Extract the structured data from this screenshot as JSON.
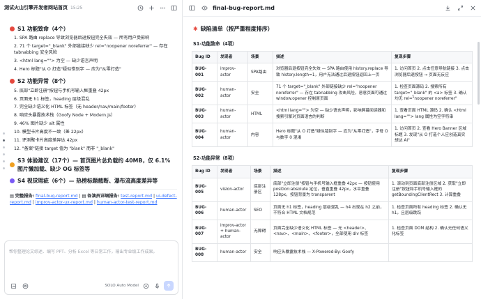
{
  "left": {
    "title": "测试火山引擎开发者网站首页",
    "time": "15:25",
    "sections": [
      {
        "color": "#e5483e",
        "heading": "S1 功能致命（4个）",
        "items": [
          "1. SPA 路由 replace 导致浏览器后退按钮完全失效 — 所有用户受影响",
          "2. 71 个 target=\"_blank\" 外部链接缺少 rel=\"noopener noreferrer\" — 存在 tabnabbing 安全风险",
          "3. <html lang=\"\"> 为空 — 缺少语言声明",
          "4. Hero 标题\"从 O 打造\"疑似错别字 — 应为\"从零打造\""
        ]
      },
      {
        "color": "#e5483e",
        "heading": "S2 功能异常（8个）",
        "items": [
          "5. 底部\"立即注册\"按钮与手机号输入框重叠 42px",
          "6. 页面无 h1 标签，heading 层级混乱",
          "7. 完全缺少语义化 HTML 标签（无 header/nav/main/footer）",
          "8. 响应头暴露技术栈（Goofy Node + Modern.js）",
          "9. 46% 图片缺少 alt 属性",
          "10. 模型卡片高度不一致（差 22px）",
          "11. 评测聚卡片高度差异达 42px",
          "12. \"备案\"链接 target 值为 \"blank\" 而非 \"_blank\""
        ]
      },
      {
        "color": "#f0a020",
        "heading": "S3 体验建议（17个）— 首页图片总负载约 40MB，仅 6.1% 图片懒加载、缺少 OG 标签等",
        "items": []
      },
      {
        "color": "#7a5af5",
        "heading": "S4 视觉瑕疵（6个）— 热榜标题截断、瀑布流高度差异等",
        "items": []
      }
    ],
    "report": {
      "icon_label": "完整报告:",
      "main_link": "final-bug-report.md",
      "sep1": " | ",
      "sub_label": "各演员详细报告:",
      "links": [
        "test-report.md",
        "ui-defect-report.md",
        "improv-actor-ux-report.md",
        "human-actor-test-report.md"
      ]
    },
    "composer": {
      "placeholder": "帮你整理论文综述、编写 PPT、分析 Excel 等日常工作，输出专业级工作成果。",
      "model": "SOLO Auto Model"
    }
  },
  "right": {
    "filename": "final-bug-report.md",
    "heading": "缺陷清单（按严重程度排序）",
    "table1": {
      "title": "S1-功能致命（4项）",
      "headers": [
        "Bug ID",
        "发现者",
        "场景",
        "描述",
        "复现步骤"
      ],
      "rows": [
        [
          "BUG-001",
          "improv-actor",
          "SPA路由",
          "浏览器后退按钮完全失效 — SPA 路由使用 history.replace 导致 history.length=1，用户无法通过后退按钮返回上一页",
          "1. 访问首页 2. 点击任意导航链接 3. 点击浏览器后退按钮 → 页面无反应"
        ],
        [
          "BUG-002",
          "human-actor",
          "安全",
          "71 个 target=\"_blank\" 外部链接缺少 rel=\"noopener noreferrer\" — 存在 tabnabbing 攻击风险，恶意页面可通过 window.opener 控制原页面",
          "1. 检查页面源码 2. 搜索所有 target=\"_blank\" 的 <a> 标签 3. 确认均无 rel=\"noopener noreferrer\""
        ],
        [
          "BUG-003",
          "human-actor",
          "HTML",
          "<html lang=\"\"> 为空 — 缺少语言声明，影响屏幕阅读器和搜索引擎对页面语言的判断",
          "1. 查看页面 HTML 源码 2. 确认 <html lang=\"\"> lang 属性为空字符串"
        ],
        [
          "BUG-004",
          "human-actor",
          "内容",
          "Hero 标题\"从 O 打造\"疑似错别字 — 应为\"从零打造\"，字母 O 与数字 0 混淆",
          "1. 访问首页 2. 查看 Hero Banner 区域标题 3. 发现\"从 O 打造个人应创造真实想达 AI\""
        ]
      ]
    },
    "table2": {
      "title": "S2-功能异常（8项）",
      "headers": [
        "Bug ID",
        "发现者",
        "场景",
        "描述",
        "复现步骤"
      ],
      "rows": [
        [
          "BUG-005",
          "vision-actor",
          "底部注册区",
          "底部\"立即注册\"按钮与手机号输入框重叠 42px — 按钮使用 position:absolute 定位，垂直重叠 42px，水平重叠 128px，按钮背景为 transparent",
          "1. 滚动到页面底部注册区域 2. 获取\"立即注册\"按钮和手机号输入框的 getBoundingClientRect 3. 计算重叠"
        ],
        [
          "BUG-006",
          "human-actor",
          "SEO",
          "页面无 h1 标签，heading 层级混乱 — h4 出现在 h2 之前，不符合 HTML 文档规范",
          "1. 检查页面所有 heading 标签 2. 确认无 h1，且层级跳跃"
        ],
        [
          "BUG-007",
          "improv-actor + human-actor",
          "无障碍",
          "页面完全缺少语义化 HTML 标签 — 无 <header>、<nav>、<main>、<footer>，全部使用 div 标签",
          "1. 检查页面 DOM 结构 2. 确认无任何语义化标签"
        ],
        [
          "BUG-008",
          "human-actor",
          "安全",
          "响应头暴露技术栈 — X-Powered-By: Goofy",
          ""
        ]
      ]
    }
  }
}
